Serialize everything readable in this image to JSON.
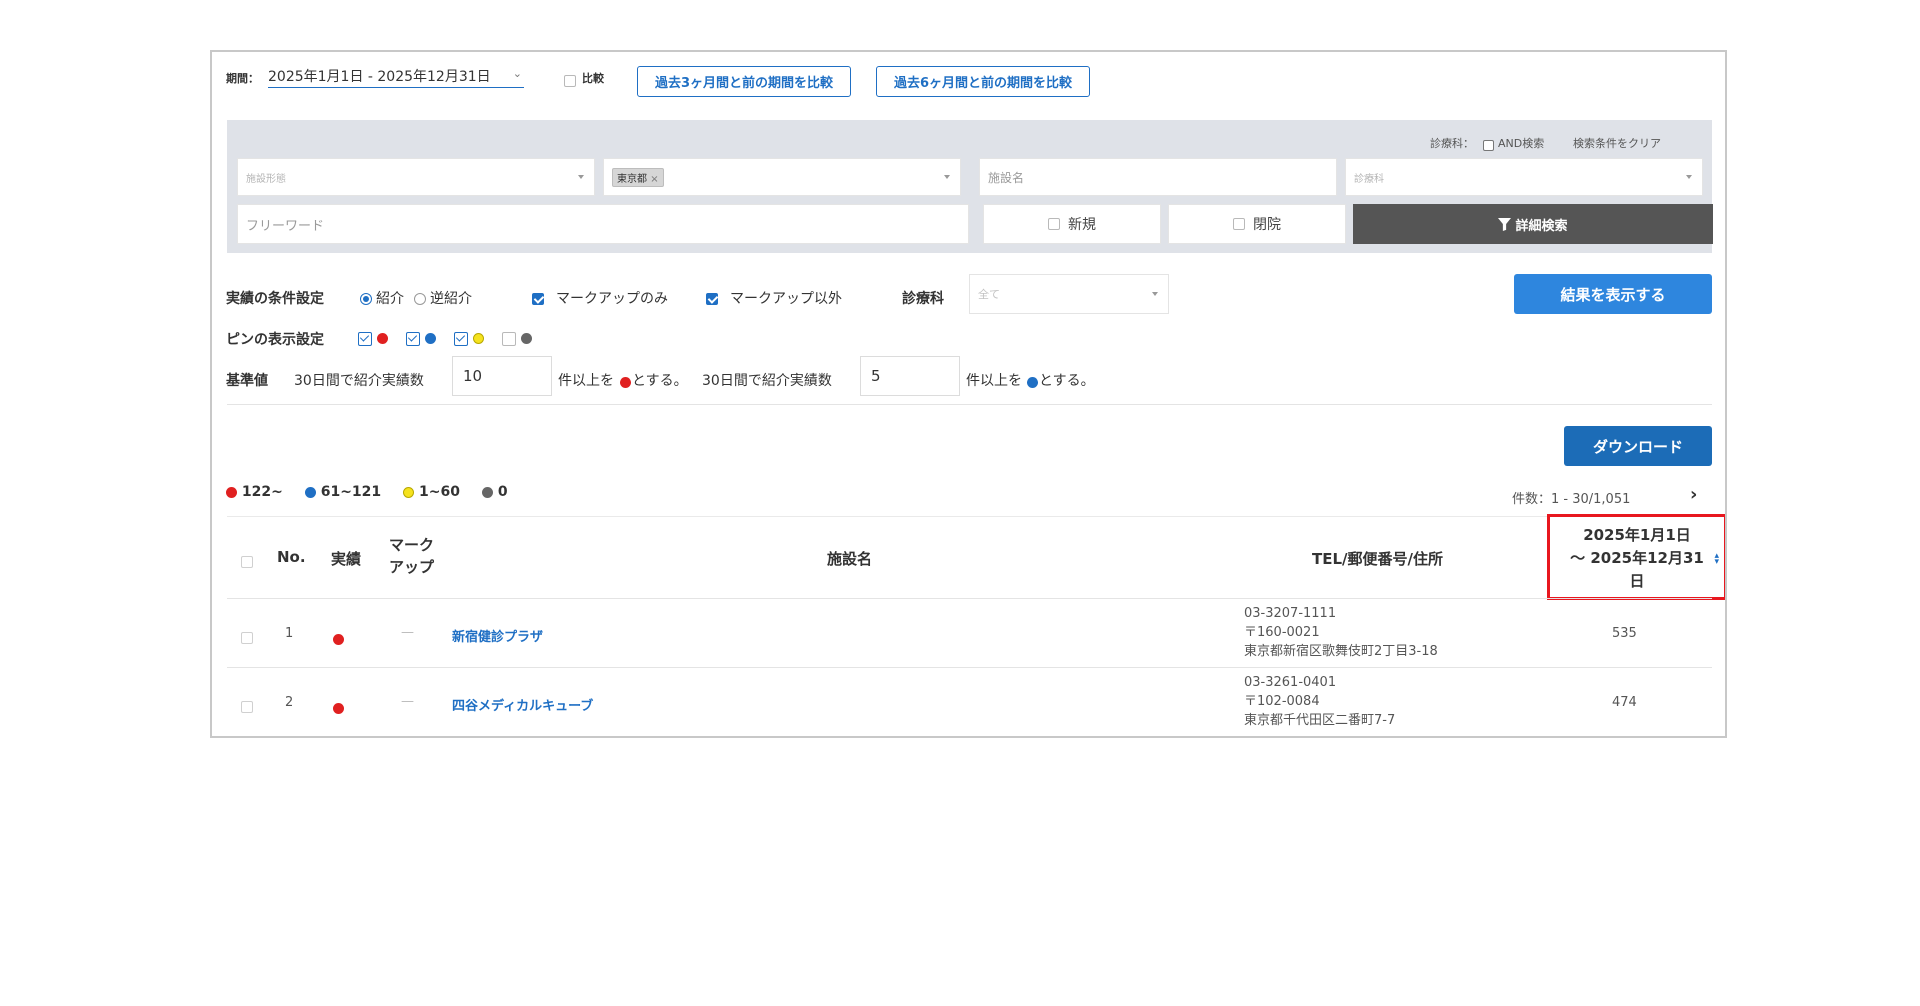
{
  "period": {
    "label": "期間：",
    "value": "2025年1月1日 - 2025年12月31日",
    "compare_label": "比較",
    "compare_3m_button": "過去3ヶ月間と前の期間を比較",
    "compare_6m_button": "過去6ヶ月間と前の期間を比較"
  },
  "search": {
    "department_label": "診療科：",
    "and_search_label": "AND検索",
    "clear_label": "検索条件をクリア",
    "facility_type_placeholder": "施設形態",
    "prefecture_tag": "東京都",
    "facility_name_placeholder": "施設名",
    "department_placeholder": "診療科",
    "freeword_placeholder": "フリーワード",
    "new_label": "新規",
    "closed_label": "閉院",
    "detail_search_label": "詳細検索"
  },
  "conditions": {
    "performance_label": "実績の条件設定",
    "referral_label": "紹介",
    "reverse_referral_label": "逆紹介",
    "markup_only_label": "マークアップのみ",
    "markup_other_label": "マークアップ以外",
    "department_label": "診療科",
    "department_value": "全て",
    "show_results_button": "結果を表示する",
    "pin_label": "ピンの表示設定",
    "baseline_label": "基準値",
    "baseline_text1": "30日間で紹介実績数",
    "baseline_value1": "10",
    "baseline_text2": "件以上を",
    "baseline_text3": "とする。",
    "baseline_text4": "30日間で紹介実績数",
    "baseline_value2": "5",
    "baseline_text5": "件以上を",
    "baseline_text6": "とする。"
  },
  "download_button": "ダウンロード",
  "legend": [
    {
      "label": "122~",
      "color": "#e02020"
    },
    {
      "label": "61~121",
      "color": "#1f6fc4"
    },
    {
      "label": "1~60",
      "color": "#f5e21e"
    },
    {
      "label": "0",
      "color": "#666666"
    }
  ],
  "count_text": "件数：1 - 30/1,051",
  "next_icon": "›",
  "table": {
    "headers": {
      "no": "No.",
      "performance": "実績",
      "markup_line1": "マーク",
      "markup_line2": "アップ",
      "facility": "施設名",
      "contact": "TEL/郵便番号/住所",
      "period_line1": "2025年1月1日",
      "period_line2": "〜 2025年12月31",
      "period_line3": "日"
    },
    "rows": [
      {
        "no": "1",
        "markup": "—",
        "name": "新宿健診プラザ",
        "tel": "03-3207-1111",
        "zip": "〒160-0021",
        "address": "東京都新宿区歌舞伎町2丁目3-18",
        "value": "535"
      },
      {
        "no": "2",
        "markup": "—",
        "name": "四谷メディカルキューブ",
        "tel": "03-3261-0401",
        "zip": "〒102-0084",
        "address": "東京都千代田区二番町7-7",
        "value": "474"
      }
    ]
  },
  "colors": {
    "accent": "#2e86de",
    "dark_button": "#555555",
    "red": "#e02020",
    "blue": "#1f6fc4",
    "highlight": "#e8171f"
  }
}
